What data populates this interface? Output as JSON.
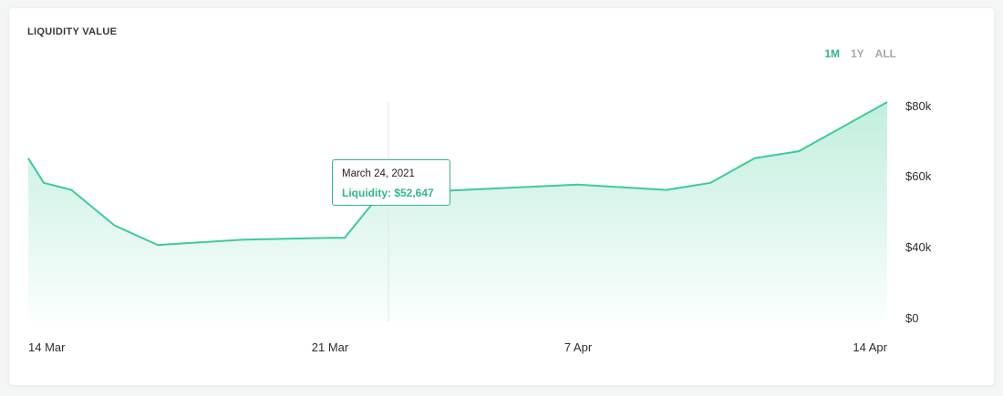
{
  "header": {
    "title": "LIQUIDITY VALUE",
    "ranges": [
      {
        "label": "1M",
        "active": true
      },
      {
        "label": "1Y",
        "active": false
      },
      {
        "label": "ALL",
        "active": false
      }
    ]
  },
  "tooltip": {
    "date": "March 24, 2021",
    "label": "Liquidity:",
    "value": "$52,647",
    "text": "Liquidity: $52,647"
  },
  "colors": {
    "accent": "#2fb889",
    "line": "#3ecb96"
  },
  "chart_data": {
    "type": "area",
    "title": "LIQUIDITY VALUE",
    "xlabel": "",
    "ylabel": "",
    "x_tick_labels": [
      "14 Mar",
      "21 Mar",
      "7 Apr",
      "14 Apr"
    ],
    "x_ticks": [
      "2021-03-14",
      "2021-03-21",
      "2021-04-07",
      "2021-04-14"
    ],
    "y_tick_labels": [
      "$0",
      "$40k",
      "$60k",
      "$80k"
    ],
    "y_ticks": [
      0,
      40000,
      60000,
      80000
    ],
    "grid": false,
    "legend": "none",
    "highlight": {
      "x": "2021-03-24",
      "y": 52647
    },
    "series": [
      {
        "points": [
          {
            "x": "2021-03-14",
            "y": 65000
          },
          {
            "x": "2021-03-14",
            "y": 58000
          },
          {
            "x": "2021-03-15",
            "y": 56000
          },
          {
            "x": "2021-03-16",
            "y": 46000
          },
          {
            "x": "2021-03-17",
            "y": 40500
          },
          {
            "x": "2021-03-19",
            "y": 42000
          },
          {
            "x": "2021-03-21",
            "y": 42500
          },
          {
            "x": "2021-03-22",
            "y": 42500
          },
          {
            "x": "2021-03-24",
            "y": 52647
          },
          {
            "x": "2021-03-25",
            "y": 55000
          },
          {
            "x": "2021-04-07",
            "y": 57500
          },
          {
            "x": "2021-04-09",
            "y": 56000
          },
          {
            "x": "2021-04-10",
            "y": 58000
          },
          {
            "x": "2021-04-11",
            "y": 65000
          },
          {
            "x": "2021-04-12",
            "y": 67000
          },
          {
            "x": "2021-04-13",
            "y": 74000
          },
          {
            "x": "2021-04-14",
            "y": 81000
          }
        ]
      }
    ]
  }
}
